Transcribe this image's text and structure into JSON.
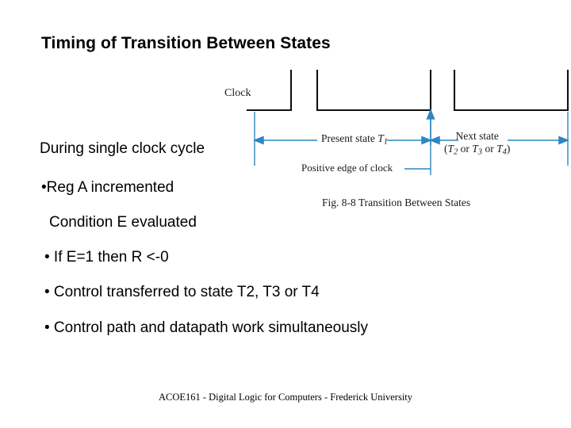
{
  "slide": {
    "title": "Timing of Transition Between States",
    "background_color": "#ffffff",
    "text_color": "#000000"
  },
  "body": {
    "lines": [
      "During single clock cycle",
      "•Reg A incremented",
      "Condition E evaluated",
      "• If E=1 then R <-0",
      "• Control transferred to state T2, T3 or T4",
      "• Control path and datapath work simultaneously"
    ]
  },
  "figure": {
    "accent_color": "#2e86c1",
    "line_color": "#1a1a1a",
    "clock_label": "Clock",
    "present_state": {
      "text_before": "Present state ",
      "symbol": "T",
      "subscript": "1"
    },
    "next_state": {
      "line1": "Next state",
      "line2_open": "(",
      "line2_t2": "T",
      "line2_t2_sub": "2",
      "line2_or1": " or ",
      "line2_t3": "T",
      "line2_t3_sub": "3",
      "line2_or2": " or ",
      "line2_t4": "T",
      "line2_t4_sub": "4",
      "line2_close": ")"
    },
    "positive_edge_label": "Positive edge of clock",
    "caption": "Fig. 8-8  Transition Between States"
  },
  "footer": {
    "text": "ACOE161 - Digital Logic for Computers - Frederick University"
  }
}
